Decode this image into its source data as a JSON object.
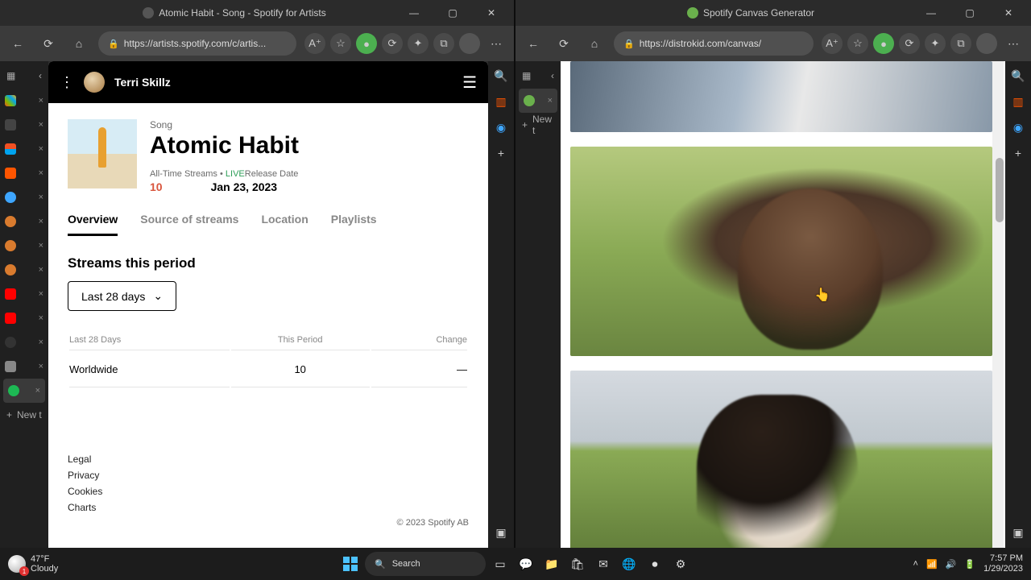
{
  "left_window": {
    "title": "Atomic Habit - Song - Spotify for Artists",
    "url": "https://artists.spotify.com/c/artis...",
    "vtabs_newtab": "New t",
    "edge_add_title": "+"
  },
  "right_window": {
    "title": "Spotify Canvas Generator",
    "url": "https://distrokid.com/canvas/",
    "vtabs_newtab": "New t"
  },
  "spotify": {
    "artist": "Terri Skillz",
    "type_label": "Song",
    "song_title": "Atomic Habit",
    "stats_label": "All-Time Streams • ",
    "stats_live": "LIVE",
    "release_label": "Release Date",
    "streams": "10",
    "release_date": "Jan 23, 2023",
    "tabs": {
      "overview": "Overview",
      "source": "Source of streams",
      "location": "Location",
      "playlists": "Playlists"
    },
    "section_title": "Streams this period",
    "dropdown": "Last 28 days",
    "table_headers": {
      "period_label": "Last 28 Days",
      "this_period": "This Period",
      "change": "Change"
    },
    "table_row": {
      "region": "Worldwide",
      "value": "10",
      "change": "—"
    },
    "footer": {
      "legal": "Legal",
      "privacy": "Privacy",
      "cookies": "Cookies",
      "charts": "Charts",
      "copyright": "© 2023 Spotify AB"
    }
  },
  "taskbar": {
    "temp": "47°F",
    "cond": "Cloudy",
    "search": "Search",
    "time": "7:57 PM",
    "date": "1/29/2023"
  }
}
